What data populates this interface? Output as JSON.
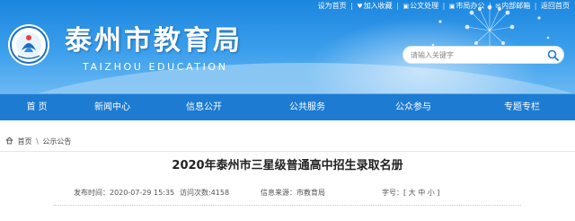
{
  "top_links": {
    "homepage": "设为首页",
    "favorite": "加入收藏",
    "public_mail": "公文处理",
    "office": "市局办公",
    "intranet": "内部邮箱",
    "back_home": "返回首页",
    "separator": "|"
  },
  "header": {
    "title": "泰州市教育局",
    "subtitle": "TAIZHOU EDUCATION",
    "search_placeholder": "请输入关键字"
  },
  "nav": {
    "items": [
      {
        "label": "首 页"
      },
      {
        "label": "新闻中心"
      },
      {
        "label": "信息公开"
      },
      {
        "label": "公共服务"
      },
      {
        "label": "公众参与"
      },
      {
        "label": "专题专栏"
      }
    ]
  },
  "breadcrumb": {
    "home": "首页",
    "separator": "\\",
    "current": "公示公告"
  },
  "article": {
    "title": "2020年泰州市三星级普通高中招生录取名册",
    "publish_time": "发布时间：2020-07-29 15:35",
    "views": "访问次数:4158",
    "source": "信息来源：市教育局",
    "font_size_label": "字号：[ 大 中 小 ]"
  },
  "colors": {
    "header_blue": "#1b86df",
    "nav_blue": "#1d7bd1",
    "text_dark": "#222222"
  }
}
